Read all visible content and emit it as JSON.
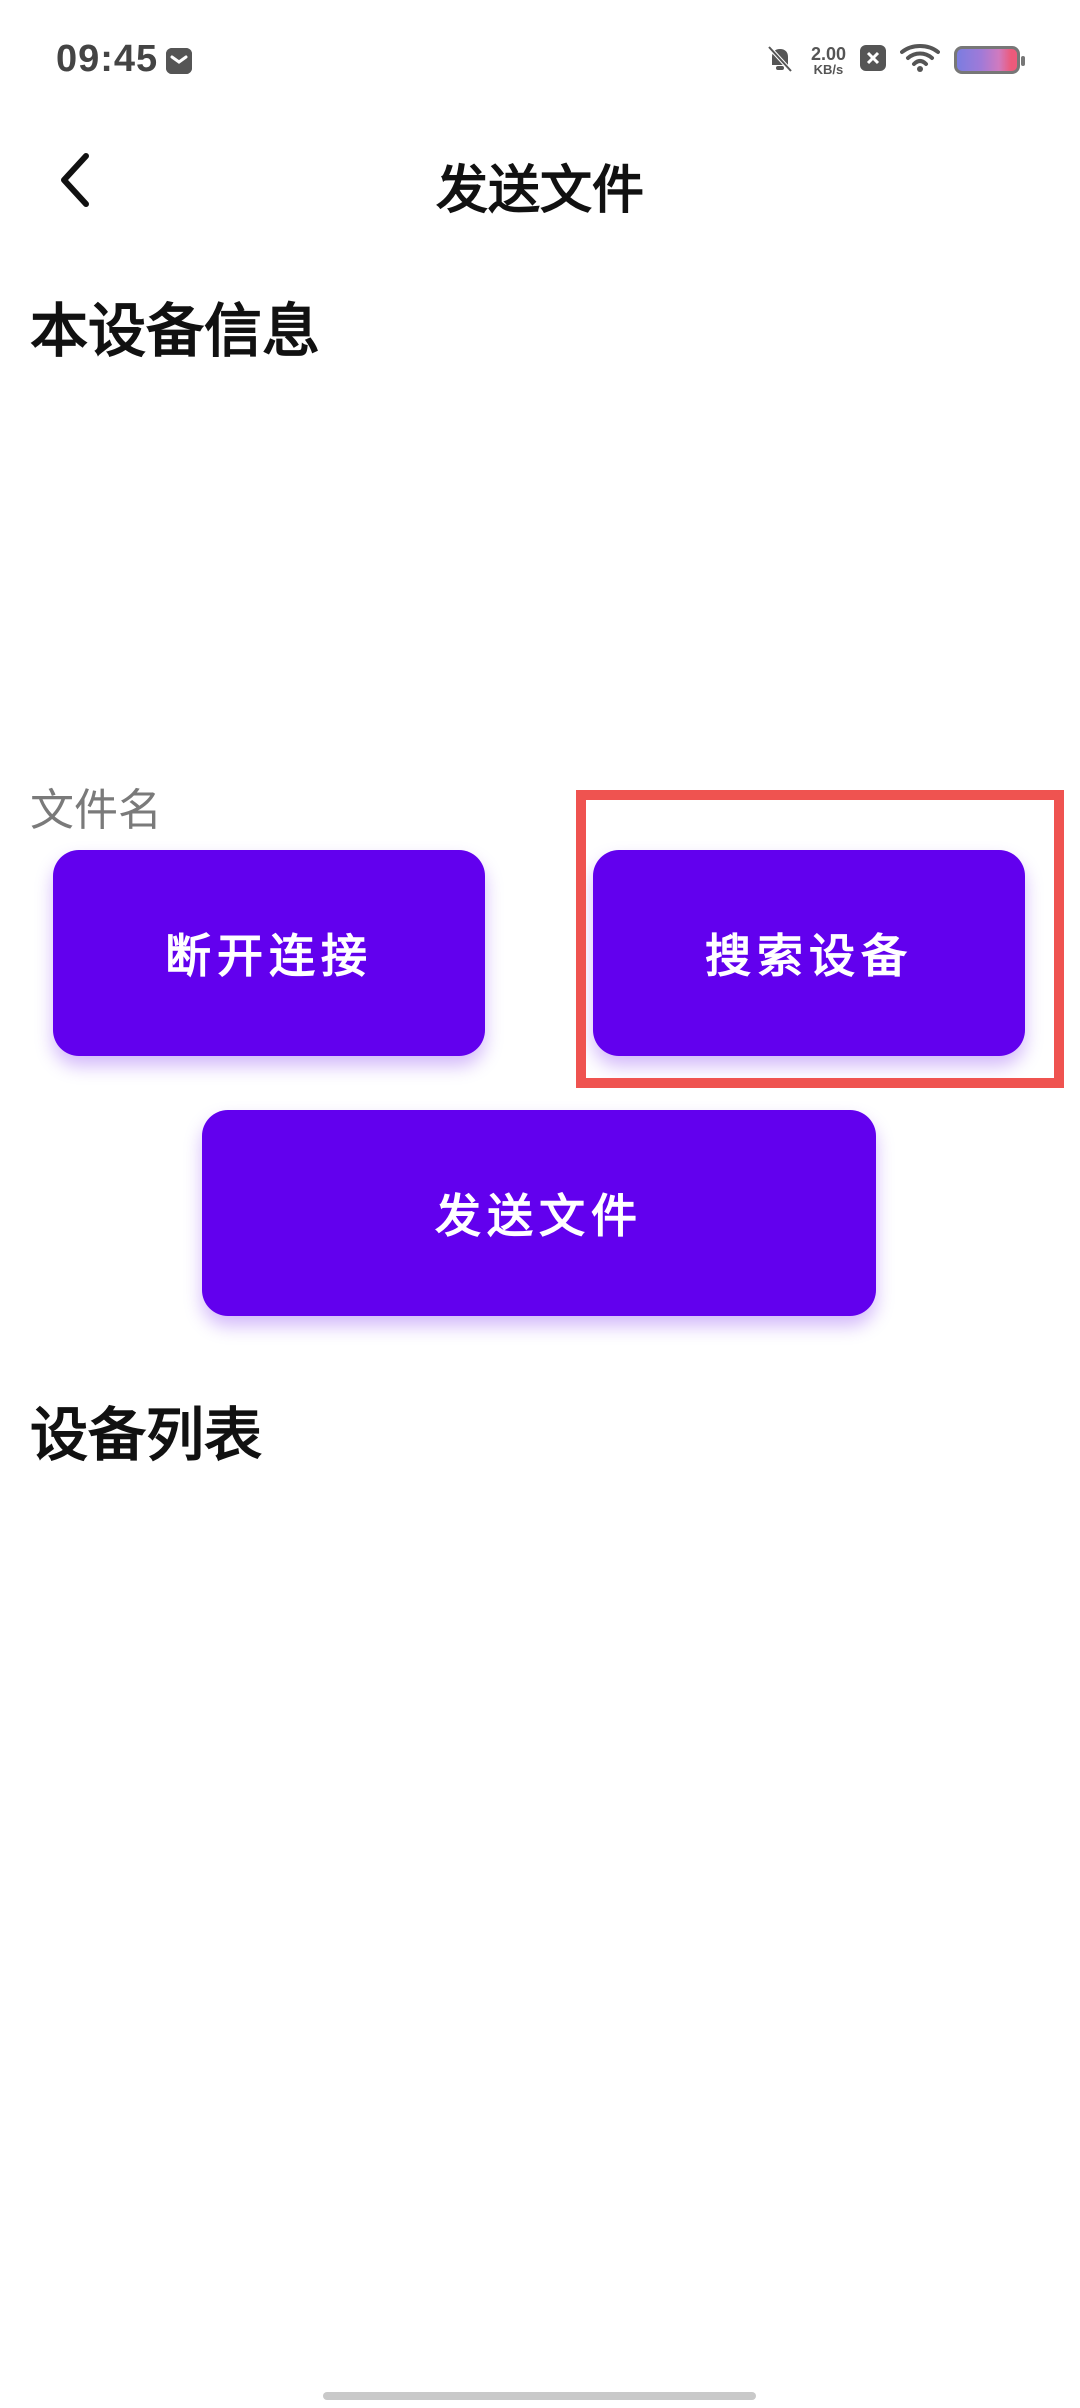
{
  "status_bar": {
    "time": "09:45",
    "net_speed_value": "2.00",
    "net_speed_unit": "KB/s",
    "icons": [
      "notification-icon",
      "mute-icon",
      "close-square-icon",
      "wifi-icon",
      "battery-icon"
    ]
  },
  "header": {
    "title": "发送文件",
    "back_icon": "chevron-left-icon"
  },
  "sections": {
    "device_info_title": "本设备信息",
    "device_list_title": "设备列表"
  },
  "file": {
    "label": "文件名"
  },
  "buttons": {
    "disconnect": "断开连接",
    "search_devices": "搜索设备",
    "send_file": "发送文件"
  },
  "colors": {
    "primary": "#6200EE",
    "highlight": "#EF5350",
    "text": "#111111",
    "muted": "#7A7A7A"
  }
}
